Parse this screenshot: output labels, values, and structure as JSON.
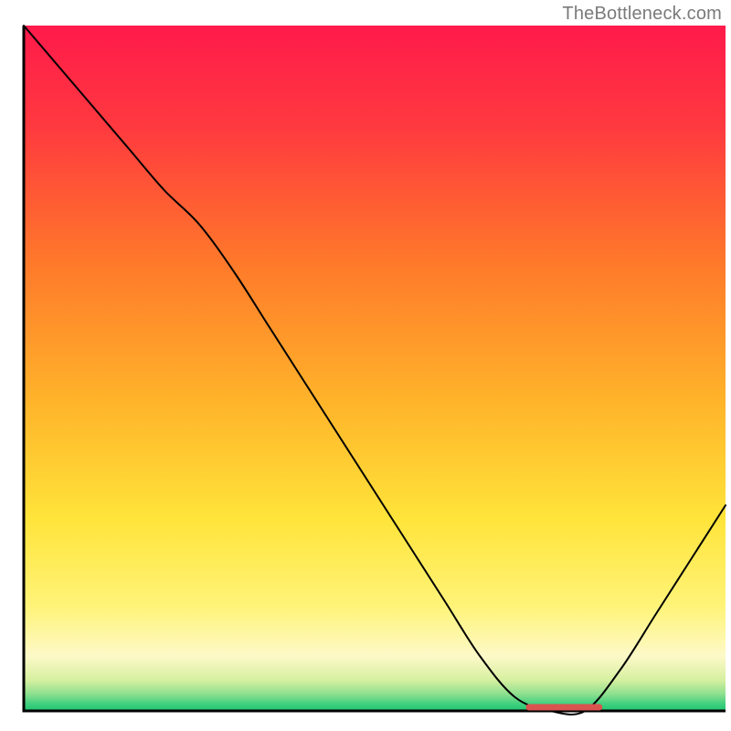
{
  "attribution": "TheBottleneck.com",
  "chart_data": {
    "type": "line",
    "title": "",
    "xlabel": "",
    "ylabel": "",
    "xlim": [
      0,
      100
    ],
    "ylim": [
      0,
      100
    ],
    "grid": false,
    "series": [
      {
        "name": "curve",
        "x": [
          0,
          5,
          10,
          15,
          20,
          25,
          30,
          35,
          40,
          45,
          50,
          55,
          60,
          65,
          70,
          75,
          80,
          85,
          90,
          95,
          100
        ],
        "values": [
          100,
          94,
          88,
          82,
          76,
          71,
          64,
          56,
          48,
          40,
          32,
          24,
          16,
          8,
          2,
          0,
          0,
          6,
          14,
          22,
          30
        ]
      }
    ],
    "flat_marker": {
      "x_start": 72,
      "x_end": 82,
      "y": 0,
      "color": "#d9534f"
    },
    "gradient_stops": [
      {
        "offset": 0.0,
        "color": "#ff1a4b"
      },
      {
        "offset": 0.15,
        "color": "#ff3a3f"
      },
      {
        "offset": 0.35,
        "color": "#ff7a2a"
      },
      {
        "offset": 0.55,
        "color": "#ffb42a"
      },
      {
        "offset": 0.72,
        "color": "#ffe43a"
      },
      {
        "offset": 0.85,
        "color": "#fff47a"
      },
      {
        "offset": 0.92,
        "color": "#fdf9c8"
      },
      {
        "offset": 0.955,
        "color": "#d6f0a0"
      },
      {
        "offset": 0.975,
        "color": "#8fe08f"
      },
      {
        "offset": 0.99,
        "color": "#3fd07f"
      },
      {
        "offset": 1.0,
        "color": "#1fc56f"
      }
    ],
    "axes_color": "#000000",
    "line_color": "#000000",
    "line_width": 2
  }
}
